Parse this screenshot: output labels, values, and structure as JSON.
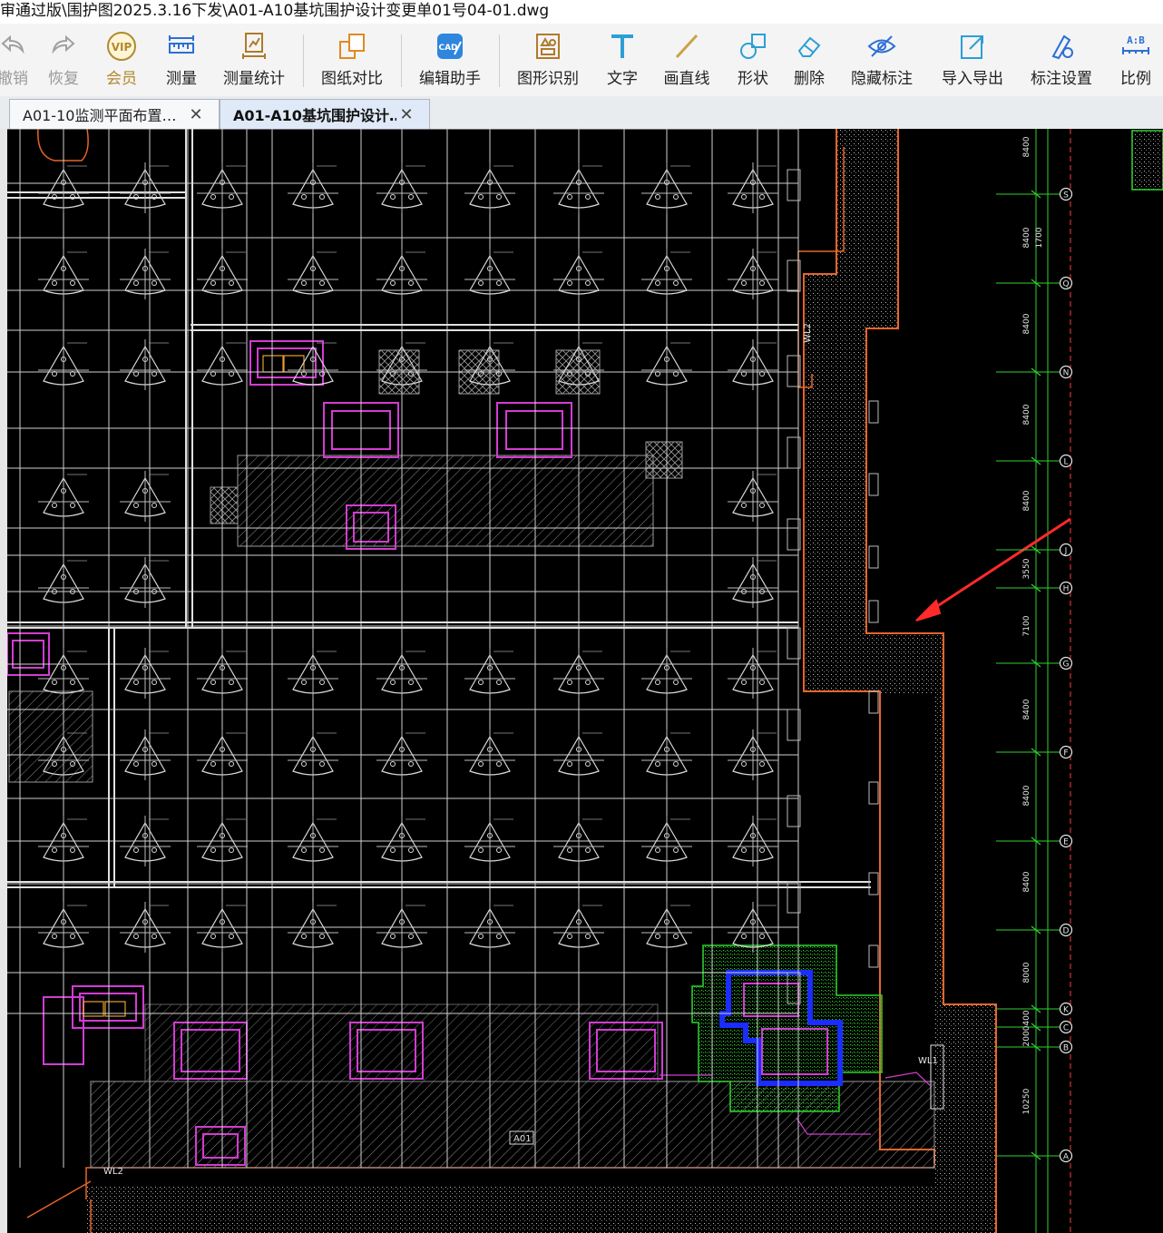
{
  "window": {
    "title": "审通过版\\围护图2025.3.16下发\\A01-A10基坑围护设计变更单01号04-01.dwg"
  },
  "toolbar": {
    "items": [
      {
        "label": "撤销",
        "icon": "undo-icon"
      },
      {
        "label": "恢复",
        "icon": "redo-icon"
      },
      {
        "label": "会员",
        "icon": "vip-icon"
      },
      {
        "label": "测量",
        "icon": "ruler-icon"
      },
      {
        "label": "测量统计",
        "icon": "measure-stats-icon"
      },
      {
        "label": "图纸对比",
        "icon": "compare-icon"
      },
      {
        "label": "编辑助手",
        "icon": "cad-edit-icon"
      },
      {
        "label": "图形识别",
        "icon": "shape-recognize-icon"
      },
      {
        "label": "文字",
        "icon": "text-icon"
      },
      {
        "label": "画直线",
        "icon": "line-icon"
      },
      {
        "label": "形状",
        "icon": "shape-icon"
      },
      {
        "label": "删除",
        "icon": "eraser-icon"
      },
      {
        "label": "隐藏标注",
        "icon": "hide-eye-icon"
      },
      {
        "label": "导入导出",
        "icon": "import-export-icon"
      },
      {
        "label": "标注设置",
        "icon": "annotation-settings-icon"
      },
      {
        "label": "比例",
        "icon": "scale-icon"
      }
    ],
    "vip_text": "VIP",
    "cad_badge": "CAD",
    "scale_text": "A:B"
  },
  "tabs": [
    {
      "label": "A01-10监测平面布置…",
      "active": false
    },
    {
      "label": "A01-A10基坑围护设计…",
      "active": true
    }
  ],
  "drawing": {
    "axis_labels": [
      "S",
      "Q",
      "N",
      "L",
      "J",
      "H",
      "G",
      "F",
      "E",
      "D",
      "K",
      "C",
      "B",
      "A"
    ],
    "dimensions": [
      "8400",
      "8400",
      "1700",
      "8400",
      "8400",
      "8400",
      "3550",
      "7100",
      "8400",
      "8400",
      "8400",
      "8000",
      "400",
      "2000",
      "10250"
    ],
    "callouts": [
      "A01",
      "WL2",
      "WL1",
      "WL2"
    ],
    "colors": {
      "background": "#000000",
      "boundary": "#e8642a",
      "grid": "#cfcfcf",
      "magenta": "#d23cd2",
      "green": "#2fd22f",
      "blue": "#1b2cff",
      "arrow": "#ff2a2a"
    }
  }
}
